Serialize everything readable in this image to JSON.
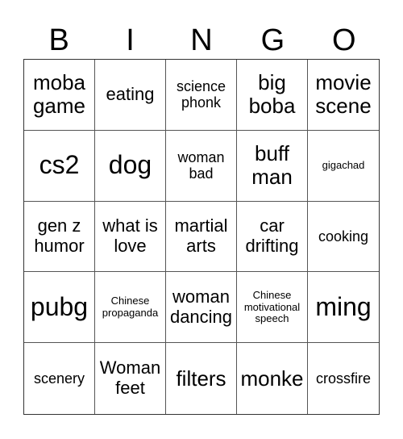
{
  "header": {
    "letters": [
      "B",
      "I",
      "N",
      "G",
      "O"
    ]
  },
  "cells": [
    {
      "text": "moba game",
      "size": "s-l"
    },
    {
      "text": "eating",
      "size": "s-m"
    },
    {
      "text": "science phonk",
      "size": "s-s"
    },
    {
      "text": "big boba",
      "size": "s-l"
    },
    {
      "text": "movie scene",
      "size": "s-l"
    },
    {
      "text": "cs2",
      "size": "s-xl"
    },
    {
      "text": "dog",
      "size": "s-xl"
    },
    {
      "text": "woman bad",
      "size": "s-s"
    },
    {
      "text": "buff man",
      "size": "s-l"
    },
    {
      "text": "gigachad",
      "size": "s-xs"
    },
    {
      "text": "gen z humor",
      "size": "s-m"
    },
    {
      "text": "what is love",
      "size": "s-m"
    },
    {
      "text": "martial arts",
      "size": "s-m"
    },
    {
      "text": "car drifting",
      "size": "s-m"
    },
    {
      "text": "cooking",
      "size": "s-s"
    },
    {
      "text": "pubg",
      "size": "s-xl"
    },
    {
      "text": "Chinese propaganda",
      "size": "s-xs"
    },
    {
      "text": "woman dancing",
      "size": "s-m"
    },
    {
      "text": "Chinese motivational speech",
      "size": "s-xs"
    },
    {
      "text": "ming",
      "size": "s-xl"
    },
    {
      "text": "scenery",
      "size": "s-s"
    },
    {
      "text": "Woman feet",
      "size": "s-m"
    },
    {
      "text": "filters",
      "size": "s-l"
    },
    {
      "text": "monke",
      "size": "s-l"
    },
    {
      "text": "crossfire",
      "size": "s-s"
    }
  ]
}
